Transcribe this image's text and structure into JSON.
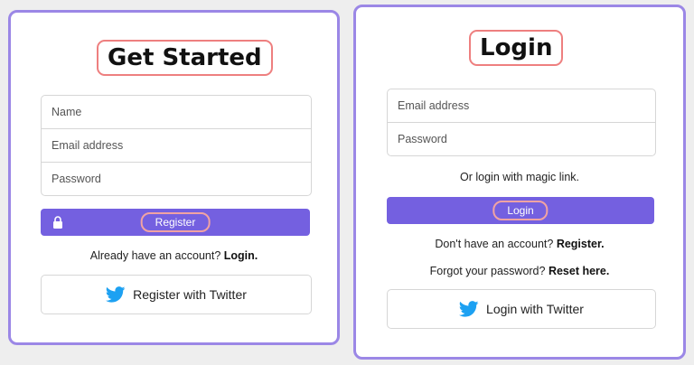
{
  "register": {
    "title": "Get Started",
    "fields": [
      {
        "placeholder": "Name"
      },
      {
        "placeholder": "Email address"
      },
      {
        "placeholder": "Password"
      }
    ],
    "submit_label": "Register",
    "account_prompt": "Already have an account?",
    "account_link": "Login.",
    "twitter_label": "Register with Twitter"
  },
  "login": {
    "title": "Login",
    "fields": [
      {
        "placeholder": "Email address"
      },
      {
        "placeholder": "Password"
      }
    ],
    "magic_link": "Or login with magic link.",
    "submit_label": "Login",
    "account_prompt": "Don't have an account?",
    "account_link": "Register.",
    "forgot_prompt": "Forgot your password?",
    "forgot_link": "Reset here.",
    "twitter_label": "Login with Twitter"
  },
  "colors": {
    "accent": "#7460e0",
    "card_border": "#9b87e6",
    "highlight": "#ee7f7f",
    "twitter": "#1da1f2"
  },
  "icons": {
    "lock": "lock-icon",
    "twitter": "twitter-icon"
  }
}
